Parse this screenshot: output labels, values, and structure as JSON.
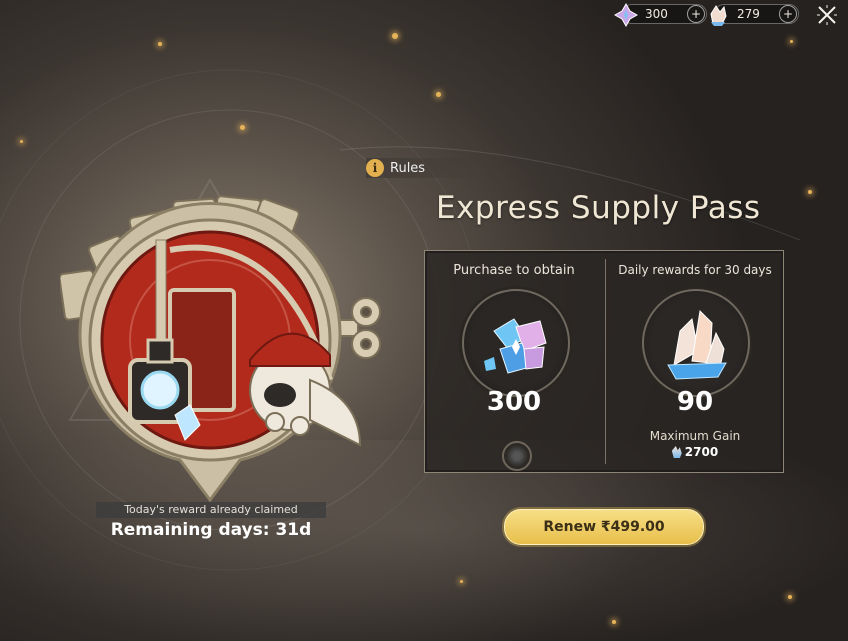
{
  "currencies": [
    {
      "name": "stellar-jade",
      "value": "300",
      "add": "+"
    },
    {
      "name": "oneiric-shard",
      "value": "279",
      "add": "+"
    }
  ],
  "badge": {
    "claimed_text": "Today's reward already claimed",
    "remaining_text": "Remaining days: 31d"
  },
  "rules": {
    "icon_text": "i",
    "label": "Rules"
  },
  "title": "Express Supply Pass",
  "panel": {
    "purchase": {
      "heading": "Purchase to obtain",
      "amount": "300"
    },
    "daily": {
      "heading": "Daily rewards for 30 days",
      "amount": "90",
      "max_label": "Maximum Gain",
      "max_value": "2700"
    }
  },
  "renew_button": "Renew ₹499.00",
  "colors": {
    "accent_gold": "#e8bf4b",
    "badge_red": "#b22a1c",
    "panel_border": "#8d8576"
  }
}
